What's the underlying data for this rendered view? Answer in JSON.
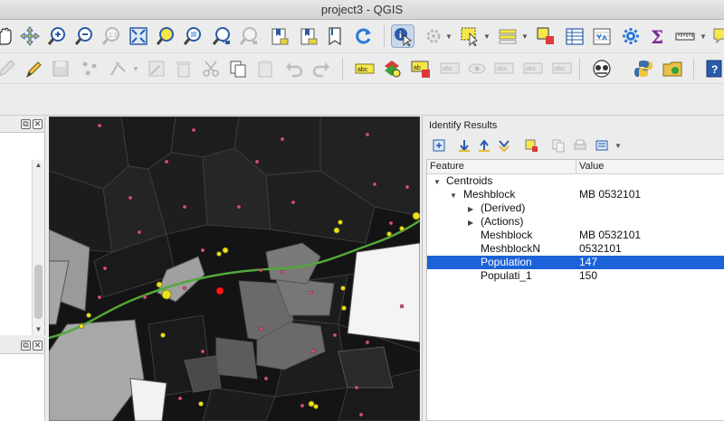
{
  "window": {
    "title": "project3 - QGIS"
  },
  "toolbar_main": {
    "items": [
      "pan-map-icon",
      "pan-to-selection-icon",
      "zoom-in-icon",
      "zoom-out-icon",
      "zoom-native-icon",
      "zoom-full-icon",
      "zoom-to-selection-icon",
      "zoom-to-layer-icon",
      "zoom-last-icon",
      "zoom-next-icon",
      "new-bookmark-icon",
      "show-bookmarks-icon",
      "refresh-icon",
      "identify-icon",
      "run-action-icon",
      "select-features-icon",
      "select-by-value-icon",
      "deselect-all-icon",
      "open-attribute-table-icon",
      "field-calculator-icon",
      "toolbox-icon",
      "statistics-icon",
      "measure-icon",
      "map-tips-icon"
    ]
  },
  "toolbar_edit": {
    "items": [
      "current-edits-icon",
      "toggle-editing-icon",
      "save-edits-icon",
      "add-feature-icon",
      "vertex-tool-icon",
      "modify-attributes-icon",
      "delete-selected-icon",
      "cut-features-icon",
      "copy-features-icon",
      "paste-features-icon",
      "undo-icon",
      "redo-icon",
      "label-icon",
      "layer-labeling-icon",
      "highlight-pinned-labels-icon",
      "pin-labels-icon",
      "show-hide-labels-icon",
      "move-label-icon",
      "rotate-label-icon",
      "change-label-icon",
      "georeferencer-icon",
      "python-console-icon",
      "plugin-manager-icon",
      "help-icon"
    ]
  },
  "identify": {
    "title": "Identify Results",
    "tools": [
      "expand-all-icon",
      "collapse-all-icon",
      "expand-new-icon",
      "clear-results-icon",
      "copy-feature-icon",
      "print-icon",
      "configure-icon"
    ],
    "columns": {
      "feature": "Feature",
      "value": "Value"
    },
    "rows": [
      {
        "feature": "Centroids",
        "value": ""
      },
      {
        "feature": "Meshblock",
        "value": "MB 0532101"
      },
      {
        "feature": "(Derived)",
        "value": ""
      },
      {
        "feature": "(Actions)",
        "value": ""
      },
      {
        "feature": "Meshblock",
        "value": "MB 0532101"
      },
      {
        "feature": "MeshblockN",
        "value": "0532101"
      },
      {
        "feature": "Population",
        "value": "147"
      },
      {
        "feature": "Populati_1",
        "value": "150"
      }
    ],
    "selected_row": "Population"
  },
  "colors": {
    "selection": "#1c62d8",
    "map_background": "#141414",
    "centroid_point": "#d9577f",
    "road_line": "#53a83a",
    "highlight_point": "#ff1a1a",
    "stop_point": "#e9e21c"
  }
}
